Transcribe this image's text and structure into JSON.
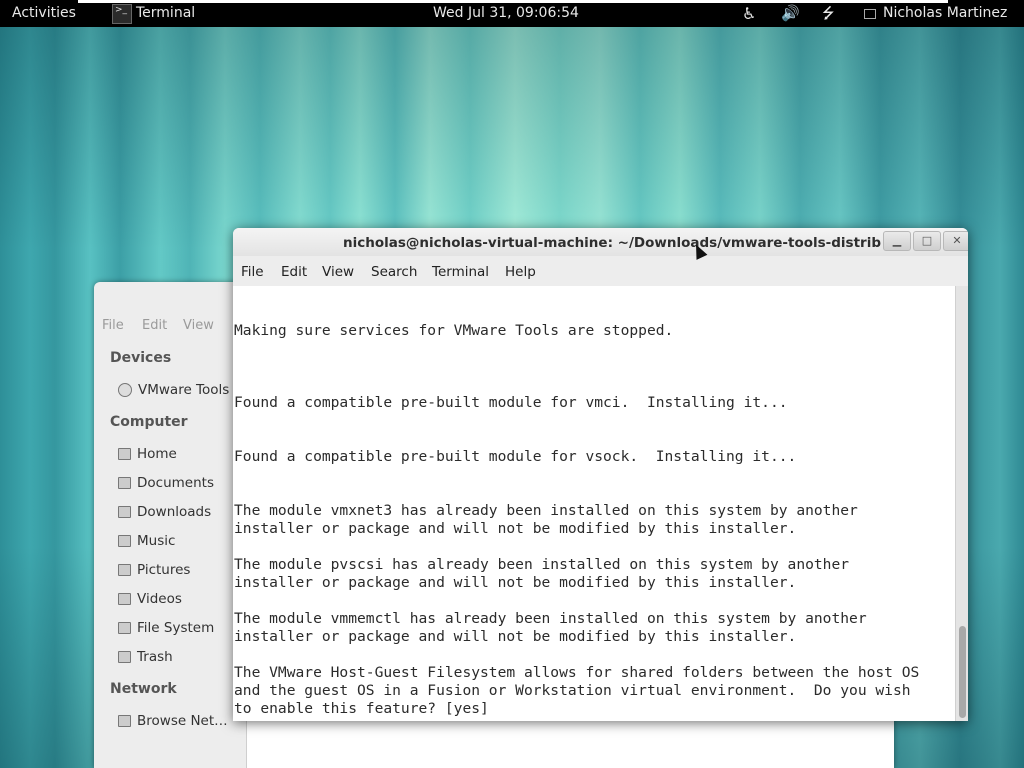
{
  "topbar": {
    "activities": "Activities",
    "app_name": "Terminal",
    "clock": "Wed Jul 31, 09:06:54",
    "user_name": "Nicholas Martinez",
    "a11y_icon": "accessibility-icon",
    "volume_icon": "volume-icon",
    "network_icon": "network-icon"
  },
  "file_manager": {
    "menu": [
      "File",
      "Edit",
      "View"
    ],
    "sections": {
      "devices": "Devices",
      "computer": "Computer",
      "network": "Network"
    },
    "devices": [
      {
        "label": "VMware Tools",
        "icon": "disc-icon"
      }
    ],
    "computer": [
      {
        "label": "Home",
        "icon": "folder-icon"
      },
      {
        "label": "Documents",
        "icon": "folder-icon"
      },
      {
        "label": "Downloads",
        "icon": "folder-icon"
      },
      {
        "label": "Music",
        "icon": "folder-icon"
      },
      {
        "label": "Pictures",
        "icon": "folder-icon"
      },
      {
        "label": "Videos",
        "icon": "folder-icon"
      },
      {
        "label": "File System",
        "icon": "drive-icon"
      },
      {
        "label": "Trash",
        "icon": "trash-icon"
      }
    ],
    "network": [
      {
        "label": "Browse Net…",
        "icon": "network-icon"
      }
    ]
  },
  "terminal": {
    "title": "nicholas@nicholas-virtual-machine: ~/Downloads/vmware-tools-distrib",
    "menu": [
      "File",
      "Edit",
      "View",
      "Search",
      "Terminal",
      "Help"
    ],
    "lines": [
      "",
      "",
      "Making sure services for VMware Tools are stopped.",
      "",
      "",
      "",
      "Found a compatible pre-built module for vmci.  Installing it...",
      "",
      "",
      "Found a compatible pre-built module for vsock.  Installing it...",
      "",
      "",
      "The module vmxnet3 has already been installed on this system by another",
      "installer or package and will not be modified by this installer.",
      "",
      "The module pvscsi has already been installed on this system by another",
      "installer or package and will not be modified by this installer.",
      "",
      "The module vmmemctl has already been installed on this system by another",
      "installer or package and will not be modified by this installer.",
      "",
      "The VMware Host-Guest Filesystem allows for shared folders between the host OS",
      "and the guest OS in a Fusion or Workstation virtual environment.  Do you wish",
      "to enable this feature? [yes]"
    ]
  }
}
